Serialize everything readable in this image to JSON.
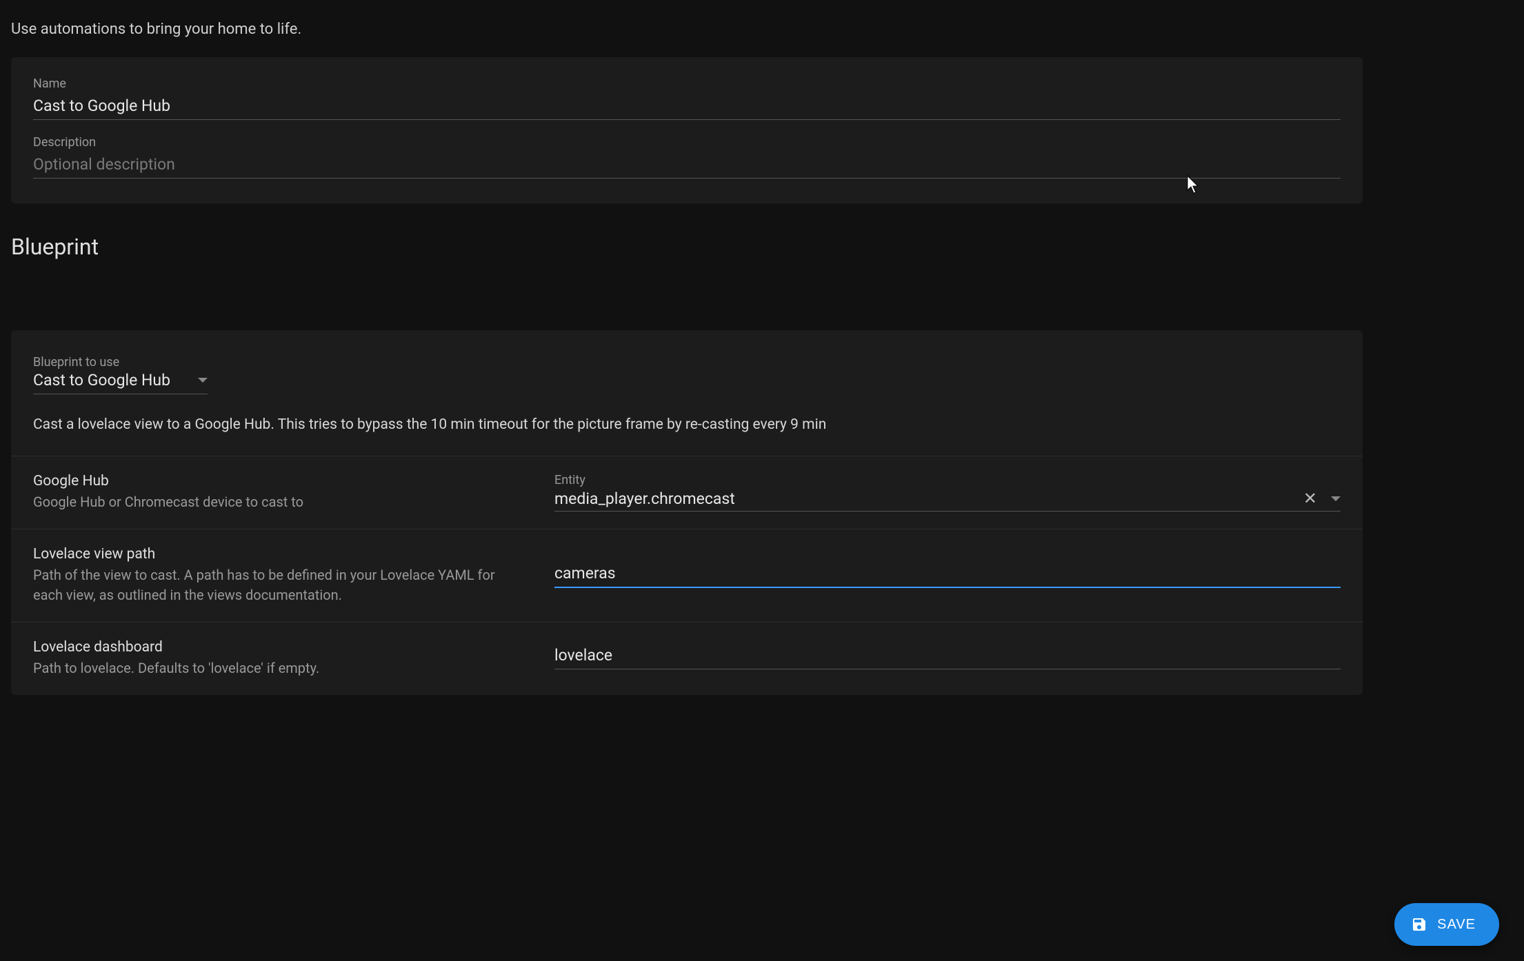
{
  "intro": "Use automations to bring your home to life.",
  "name_field": {
    "label": "Name",
    "value": "Cast to Google Hub"
  },
  "description_field": {
    "label": "Description",
    "placeholder": "Optional description",
    "value": ""
  },
  "section_heading": "Blueprint",
  "blueprint": {
    "select_label": "Blueprint to use",
    "select_value": "Cast to Google Hub",
    "description": "Cast a lovelace view to a Google Hub. This tries to bypass the 10 min timeout for the picture frame by re-casting every 9 min"
  },
  "rows": {
    "google_hub": {
      "title": "Google Hub",
      "help": "Google Hub or Chromecast device to cast to",
      "entity_label": "Entity",
      "entity_value": "media_player.chromecast"
    },
    "view_path": {
      "title": "Lovelace view path",
      "help": "Path of the view to cast. A path has to be defined in your Lovelace YAML for each view, as outlined in the views documentation.",
      "value": "cameras"
    },
    "dashboard": {
      "title": "Lovelace dashboard",
      "help": "Path to lovelace. Defaults to 'lovelace' if empty.",
      "value": "lovelace"
    }
  },
  "save_button": "SAVE"
}
